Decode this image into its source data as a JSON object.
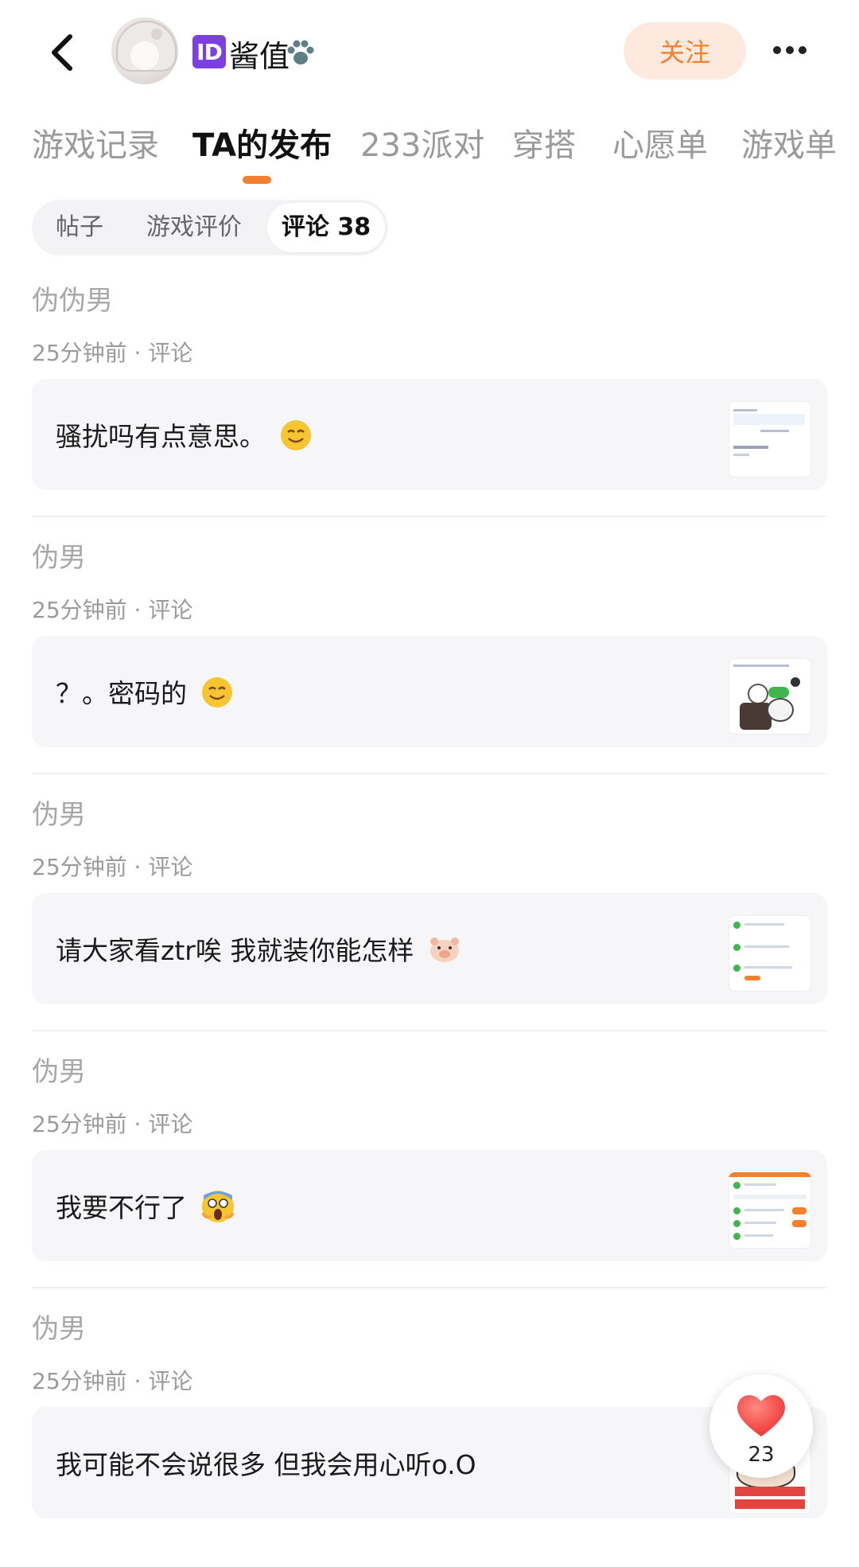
{
  "header": {
    "back_icon": "back-arrow-icon",
    "id_badge": "ID",
    "username": "酱值",
    "username_icon": "paw-icon",
    "follow_label": "关注",
    "more_icon": "more-dots-icon"
  },
  "tabs": [
    {
      "label": "游戏记录"
    },
    {
      "label": "TA的发布",
      "active": true
    },
    {
      "label": "233派对"
    },
    {
      "label": "穿搭"
    },
    {
      "label": "心愿单"
    },
    {
      "label": "游戏单"
    }
  ],
  "subtabs": [
    {
      "label": "帖子"
    },
    {
      "label": "游戏评价"
    },
    {
      "label": "评论 38",
      "active": true
    }
  ],
  "comments": [
    {
      "author": "伪伪男",
      "meta": "25分钟前 · 评论",
      "text": "骚扰吗有点意思。",
      "emoji": "smile-emoji"
    },
    {
      "author": "伪男",
      "meta": "25分钟前 · 评论",
      "text": "？。密码的",
      "emoji": "smile-emoji"
    },
    {
      "author": "伪男",
      "meta": "25分钟前 · 评论",
      "text": "请大家看ztr唉 我就装你能怎样",
      "emoji": "pig-emoji"
    },
    {
      "author": "伪男",
      "meta": "25分钟前 · 评论",
      "text": "我要不行了",
      "emoji": "scream-emoji"
    },
    {
      "author": "伪男",
      "meta": "25分钟前 · 评论",
      "text": "我可能不会说很多 但我会用心听o.O",
      "emoji": ""
    }
  ],
  "like": {
    "icon": "heart-icon",
    "count": "23"
  },
  "colors": {
    "accent": "#f2802e",
    "follow_bg": "#fde9de",
    "card_bg": "#f6f6f8",
    "id_badge": "#7b3fe4"
  }
}
